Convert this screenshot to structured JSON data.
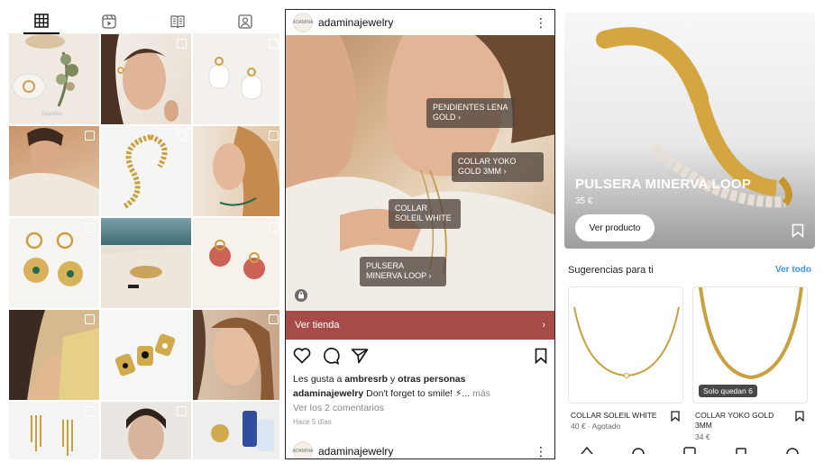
{
  "grid_panel": {
    "tabs": [
      {
        "icon": "grid-icon",
        "active": true
      },
      {
        "icon": "reels-icon",
        "active": false
      },
      {
        "icon": "guide-icon",
        "active": false
      },
      {
        "icon": "tagged-icon",
        "active": false
      }
    ],
    "watermark": "Sparkles"
  },
  "post_panel": {
    "username": "adaminajewelry",
    "avatar_text": "ADAMINA",
    "product_tags": [
      {
        "label": "PENDIENTES LENA GOLD"
      },
      {
        "label": "COLLAR YOKO GOLD 3MM"
      },
      {
        "label": "COLLAR SOLEIL WHITE"
      },
      {
        "label": "PULSERA MINERVA LOOP"
      }
    ],
    "shop_bar_label": "Ver tienda",
    "likes": {
      "prefix": "Les gusta a",
      "user": "ambresrb",
      "joiner": "y",
      "others": "otras personas"
    },
    "caption": {
      "user": "adaminajewelry",
      "text": "Don't forget to smile! ⚡...",
      "more": "más"
    },
    "comments_link": "Ver los 2 comentarios",
    "timestamp": "Hace 5 días",
    "next_post_username": "adaminajewelry"
  },
  "product_panel": {
    "title": "PULSERA MINERVA LOOP",
    "price": "35 €",
    "view_button": "Ver producto",
    "suggestions_title": "Sugerencias para ti",
    "see_all": "Ver todo",
    "suggestions": [
      {
        "name": "COLLAR SOLEIL WHITE",
        "sub": "40 € · Agotado",
        "badge": ""
      },
      {
        "name": "COLLAR YOKO GOLD 3MM",
        "sub": "34 €",
        "badge": "Solo quedan 6"
      }
    ]
  },
  "colors": {
    "shop_bar": "#a74b48",
    "link_blue": "#3897f0",
    "gold": "#c79a3a"
  }
}
